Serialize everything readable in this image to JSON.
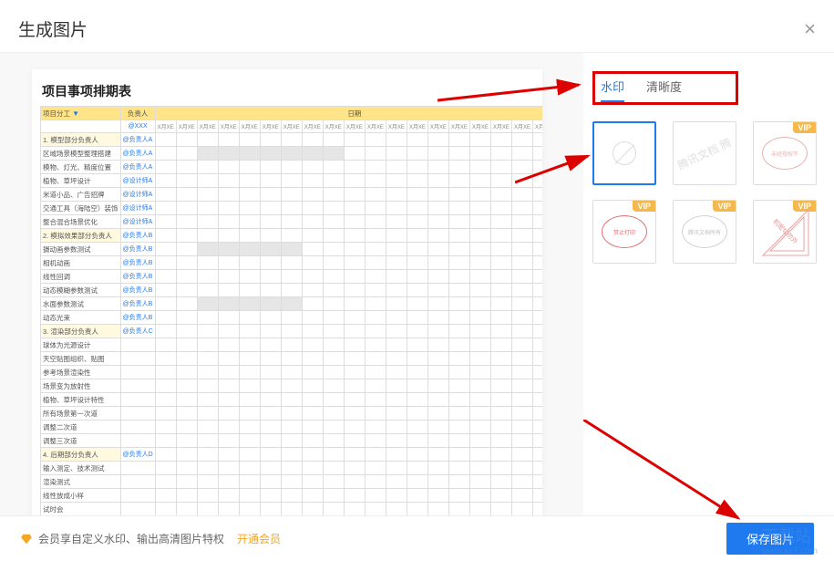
{
  "dialog": {
    "title": "生成图片"
  },
  "preview": {
    "sheet_title": "项目事项排期表",
    "header": [
      "项目分工",
      "负责人",
      "日期"
    ],
    "owner_header_value": "@XXX",
    "date_cols": [
      "X月XE",
      "X月XE",
      "X月XE",
      "X月XE",
      "X月XE",
      "X月XE",
      "X月XE",
      "X月XE",
      "X月XE",
      "X月XE",
      "X月XE",
      "X月XE",
      "X月XE",
      "X月XE",
      "X月XE",
      "X月XE",
      "X月XE",
      "X月XE",
      "X月XE"
    ],
    "rows": [
      {
        "type": "group",
        "label": "1. 模型部分负责人",
        "owner": "@负责人A"
      },
      {
        "type": "task",
        "label": "区域场景模型整理搭建",
        "owner": "@负责人A",
        "bar": [
          2,
          9
        ]
      },
      {
        "type": "task",
        "label": "模物、灯光、精度位置",
        "owner": "@负责人A"
      },
      {
        "type": "task",
        "label": "植物、草坪设计",
        "owner": "@设计师A"
      },
      {
        "type": "task",
        "label": "米道小品、广告招牌",
        "owner": "@设计师A"
      },
      {
        "type": "task",
        "label": "交通工具（海陆空）装饰",
        "owner": "@设计师A"
      },
      {
        "type": "task",
        "label": "整合混合场景优化",
        "owner": "@设计师A"
      },
      {
        "type": "group",
        "label": "2. 模拟效果部分负责人",
        "owner": "@负责人B"
      },
      {
        "type": "task",
        "label": "摄动画参数测试",
        "owner": "@负责人B",
        "bar": [
          2,
          7
        ]
      },
      {
        "type": "task",
        "label": "相机动画",
        "owner": "@负责人B"
      },
      {
        "type": "task",
        "label": "线性回调",
        "owner": "@负责人B"
      },
      {
        "type": "task",
        "label": "动态模糊参数测试",
        "owner": "@负责人B"
      },
      {
        "type": "task",
        "label": "水面参数测试",
        "owner": "@负责人B",
        "bar": [
          2,
          7
        ]
      },
      {
        "type": "task",
        "label": "动态光束",
        "owner": "@负责人B"
      },
      {
        "type": "group",
        "label": "3. 渲染部分负责人",
        "owner": "@负责人C"
      },
      {
        "type": "task",
        "label": "球体为光源设计",
        "owner": ""
      },
      {
        "type": "task",
        "label": "天空贴图组织、贴图",
        "owner": ""
      },
      {
        "type": "task",
        "label": "参考场景渲染性",
        "owner": ""
      },
      {
        "type": "task",
        "label": "场景变为放射性",
        "owner": ""
      },
      {
        "type": "task",
        "label": "植物、草坪设计特性",
        "owner": ""
      },
      {
        "type": "task",
        "label": "所有场景第一次道",
        "owner": ""
      },
      {
        "type": "task",
        "label": "调整二次道",
        "owner": ""
      },
      {
        "type": "task",
        "label": "调整三次道",
        "owner": ""
      },
      {
        "type": "group",
        "label": "4. 后期部分负责人",
        "owner": "@负责人D"
      },
      {
        "type": "task",
        "label": "输入测定、技术测试",
        "owner": ""
      },
      {
        "type": "task",
        "label": "渲染测式",
        "owner": ""
      },
      {
        "type": "task",
        "label": "线性放成小样",
        "owner": ""
      },
      {
        "type": "task",
        "label": "试时会",
        "owner": ""
      }
    ]
  },
  "tabs": {
    "watermark": "水印",
    "clarity": "清晰度"
  },
  "watermarks": {
    "none": "无",
    "tx_docs": "腾讯文档 腾",
    "unauth": "未经授权不",
    "no_print": "禁止打印",
    "tx_only": "腾讯文档所有",
    "confidential": "机密切勿外"
  },
  "vip_label": "VIP",
  "footer": {
    "promo_text": "会员享自定义水印、输出高清图片特权",
    "open_vip": "开通会员",
    "save_btn": "保存图片"
  },
  "overlay": {
    "site": "下载站",
    "url": "www.xz7.com"
  }
}
